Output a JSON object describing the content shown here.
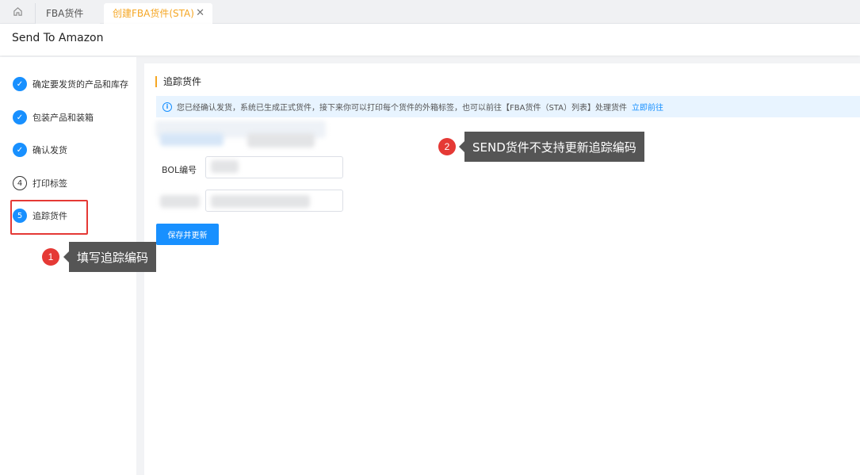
{
  "tabs": {
    "home_icon": "home-icon",
    "fba_label": "FBA货件",
    "create_label": "创建FBA货件(STA)",
    "close_glyph": "✕"
  },
  "header": {
    "title": "Send To Amazon"
  },
  "steps": [
    {
      "label": "确定要发货的产品和库存",
      "status": "done",
      "icon": "✓"
    },
    {
      "label": "包装产品和装箱",
      "status": "done",
      "icon": "✓"
    },
    {
      "label": "确认发货",
      "status": "done",
      "icon": "✓"
    },
    {
      "label": "打印标签",
      "status": "pending",
      "icon": "4"
    },
    {
      "label": "追踪货件",
      "status": "current",
      "icon": "5"
    }
  ],
  "main": {
    "section_title": "追踪货件",
    "info_text": "您已经确认发货，系统已生成正式货件，接下来你可以打印每个货件的外箱标签，也可以前往【FBA货件（STA）列表】处理货件",
    "info_link": "立即前往",
    "bol_label": "BOL编号",
    "save_button": "保存并更新"
  },
  "annotations": {
    "one": {
      "number": "1",
      "text": "填写追踪编码"
    },
    "two": {
      "number": "2",
      "text": "SEND货件不支持更新追踪编码"
    }
  },
  "colors": {
    "accent": "#1890ff",
    "tab_active": "#f5a623",
    "annotation_red": "#e53935",
    "callout_bg": "#555555"
  }
}
